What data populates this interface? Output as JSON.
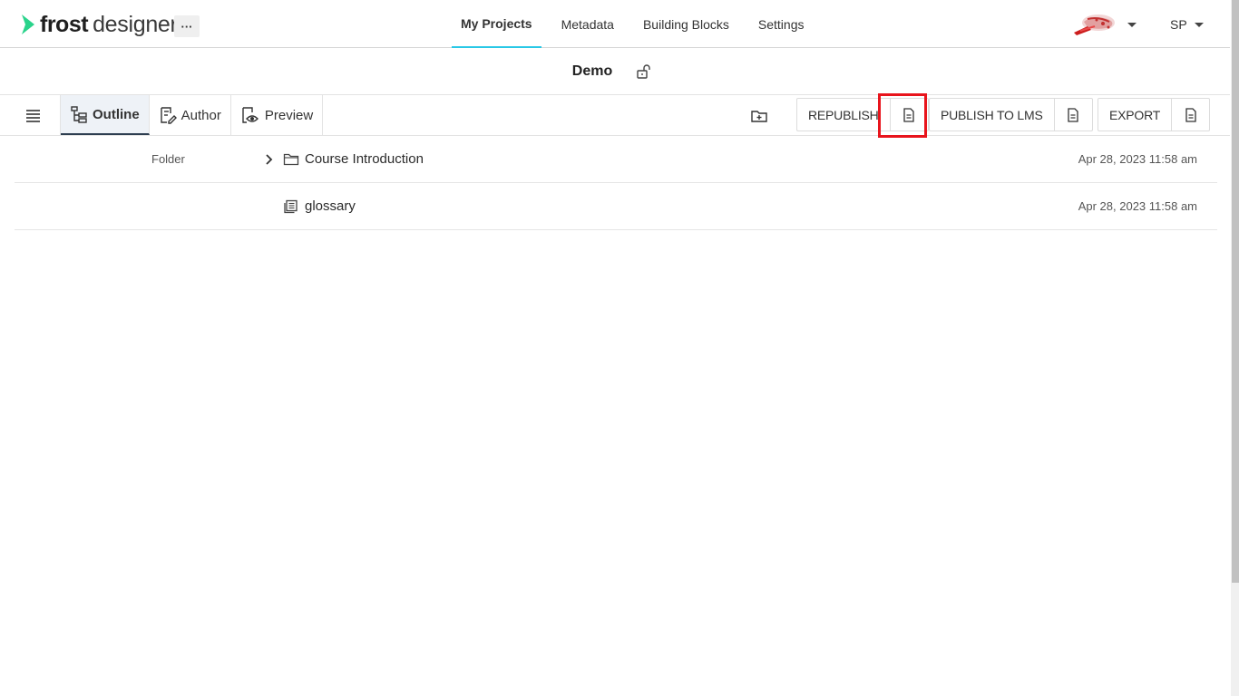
{
  "app": {
    "logo_bold": "frost",
    "logo_light": "designer",
    "more_label": "···"
  },
  "nav": {
    "items": [
      {
        "label": "My Projects",
        "active": true
      },
      {
        "label": "Metadata"
      },
      {
        "label": "Building Blocks"
      },
      {
        "label": "Settings"
      }
    ]
  },
  "user": {
    "initials": "SP"
  },
  "project": {
    "title": "Demo"
  },
  "toolbar": {
    "tabs": [
      {
        "label": "Outline",
        "icon": "outline-icon",
        "active": true
      },
      {
        "label": "Author",
        "icon": "author-icon"
      },
      {
        "label": "Preview",
        "icon": "preview-icon"
      }
    ],
    "republish_label": "REPUBLISH",
    "publish_lms_label": "PUBLISH TO LMS",
    "export_label": "EXPORT"
  },
  "rows": [
    {
      "type": "Folder",
      "name": "Course Introduction",
      "icon": "folder-icon",
      "expandable": true,
      "date": "Apr 28, 2023 11:58 am"
    },
    {
      "type": "",
      "name": "glossary",
      "icon": "glossary-icon",
      "expandable": false,
      "date": "Apr 28, 2023 11:58 am"
    }
  ],
  "colors": {
    "accent": "#28c8e6",
    "logo_green": "#2ad38b",
    "highlight": "#e8141c"
  }
}
